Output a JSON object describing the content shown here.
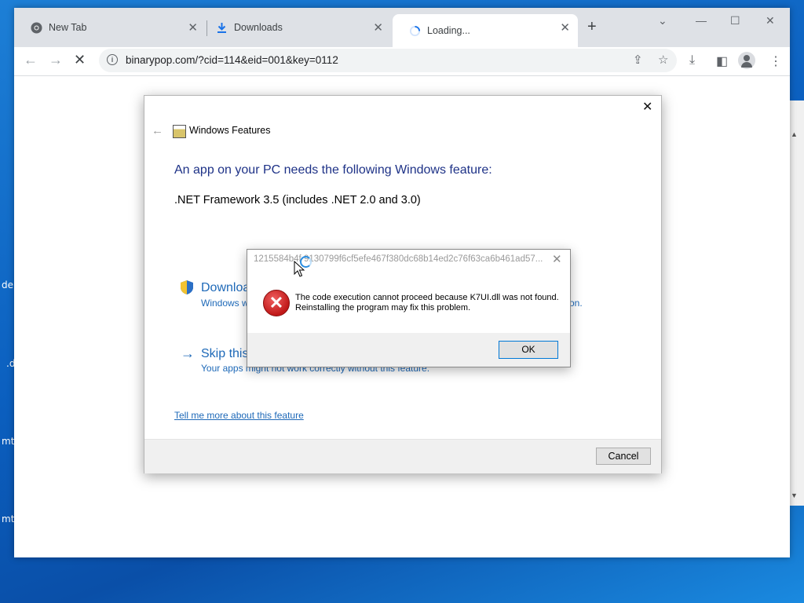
{
  "desktop": {
    "labels": [
      "de",
      ".d",
      "mt",
      "mt"
    ]
  },
  "browser": {
    "tabs": [
      {
        "label": "New Tab",
        "icon": "chrome-icon"
      },
      {
        "label": "Downloads",
        "icon": "download-icon"
      },
      {
        "label": "Loading...",
        "icon": "spinner-icon"
      }
    ],
    "address": {
      "url": "binarypop.com/?cid=114&eid=001&key=0112"
    }
  },
  "windows_features": {
    "title": "Windows Features",
    "heading": "An app on your PC needs the following Windows feature:",
    "feature": ".NET Framework 3.5 (includes .NET 2.0 and 3.0)",
    "option_download_title": "Downloa",
    "option_download_desc": "Windows w",
    "option_download_desc_tail": "on.",
    "option_skip_title": "Skip this",
    "option_skip_desc": "Your apps might not work correctly without this feature.",
    "more_link": "Tell me more about this feature",
    "cancel_label": "Cancel"
  },
  "error_dialog": {
    "title": "1215584b4f  9130799f6cf5efe467f380dc68b14ed2c76f63ca6b461ad57...",
    "message": "The code execution cannot proceed because K7UI.dll was not found. Reinstalling the program may fix this problem.",
    "ok_label": "OK"
  },
  "colors": {
    "link_blue": "#1e69b8",
    "heading_blue": "#1e3287",
    "error_red": "#c01818"
  }
}
